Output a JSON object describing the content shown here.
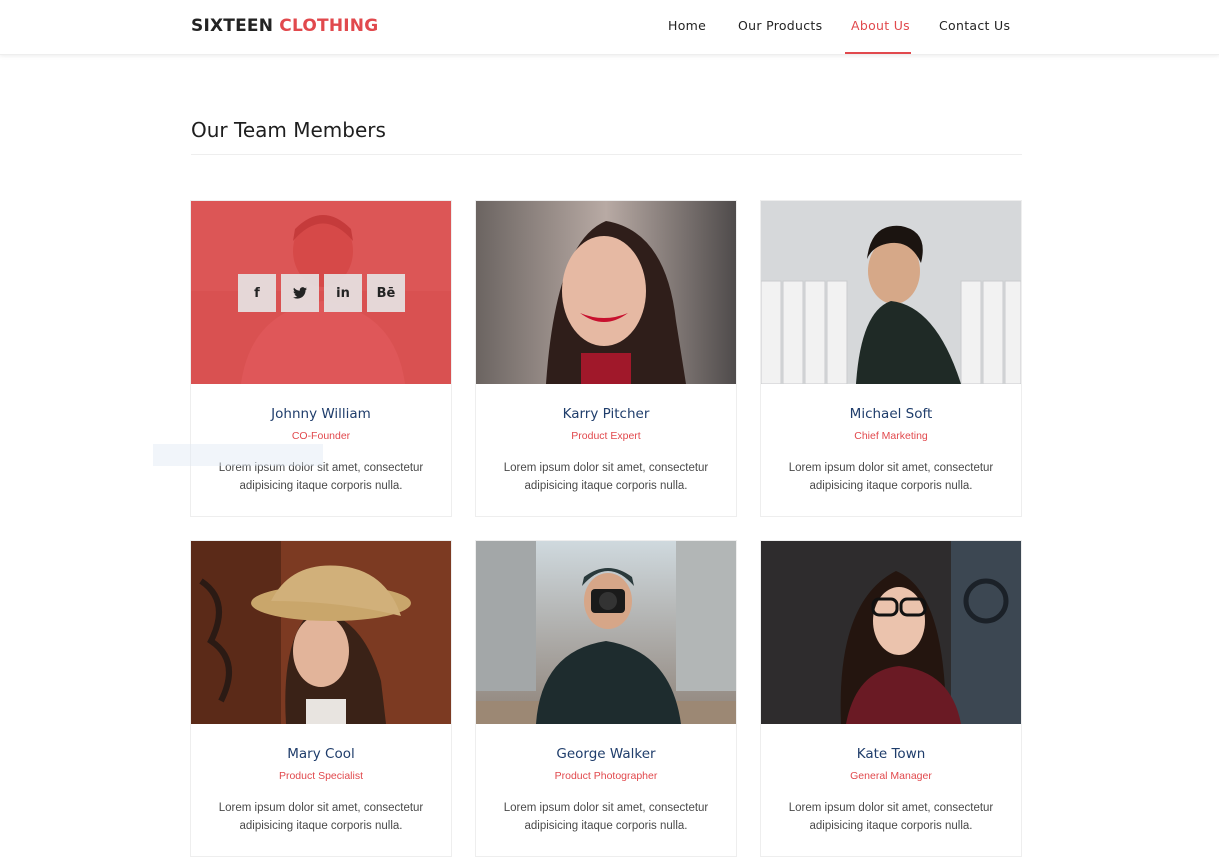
{
  "brand": {
    "name_part1": "SIXTEEN",
    "name_part2": "CLOTHING"
  },
  "nav": {
    "items": [
      {
        "label": "Home",
        "active": false
      },
      {
        "label": "Our Products",
        "active": false
      },
      {
        "label": "About Us",
        "active": true
      },
      {
        "label": "Contact Us",
        "active": false
      }
    ]
  },
  "section": {
    "title": "Our Team Members"
  },
  "team": [
    {
      "name": "Johnny William",
      "role": "CO-Founder",
      "description": "Lorem ipsum dolor sit amet, consectetur adipisicing itaque corporis nulla."
    },
    {
      "name": "Karry Pitcher",
      "role": "Product Expert",
      "description": "Lorem ipsum dolor sit amet, consectetur adipisicing itaque corporis nulla."
    },
    {
      "name": "Michael Soft",
      "role": "Chief Marketing",
      "description": "Lorem ipsum dolor sit amet, consectetur adipisicing itaque corporis nulla."
    },
    {
      "name": "Mary Cool",
      "role": "Product Specialist",
      "description": "Lorem ipsum dolor sit amet, consectetur adipisicing itaque corporis nulla."
    },
    {
      "name": "George Walker",
      "role": "Product Photographer",
      "description": "Lorem ipsum dolor sit amet, consectetur adipisicing itaque corporis nulla."
    },
    {
      "name": "Kate Town",
      "role": "General Manager",
      "description": "Lorem ipsum dolor sit amet, consectetur adipisicing itaque corporis nulla."
    }
  ],
  "social_buttons": [
    {
      "icon": "facebook-icon",
      "glyph": "f"
    },
    {
      "icon": "twitter-icon",
      "glyph": "🐦"
    },
    {
      "icon": "linkedin-icon",
      "glyph": "in"
    },
    {
      "icon": "behance-icon",
      "glyph": "Bē"
    }
  ],
  "colors": {
    "accent": "#e1494d",
    "name": "#1f3d6b",
    "overlay": "#dd3a3e"
  }
}
